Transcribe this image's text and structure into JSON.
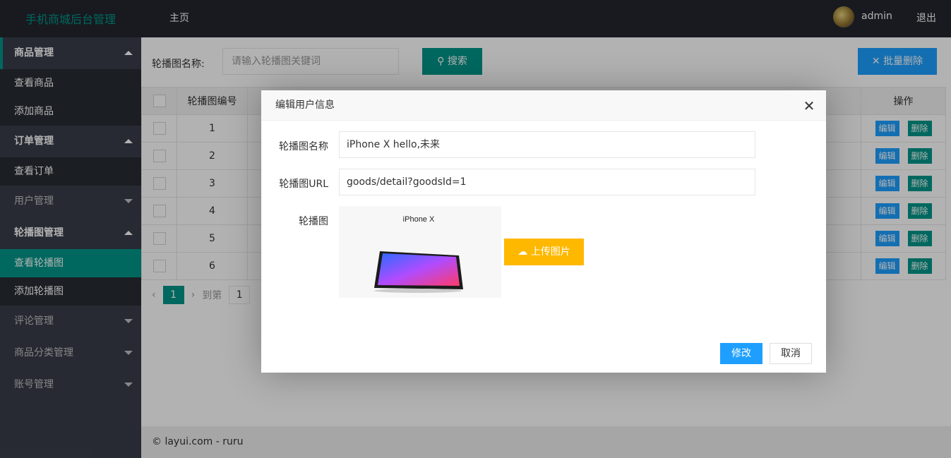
{
  "header": {
    "app_title": "手机商城后台管理",
    "nav_home": "主页",
    "username": "admin",
    "logout": "退出"
  },
  "sidebar": {
    "groups": [
      {
        "label": "商品管理",
        "items": [
          "查看商品",
          "添加商品"
        ]
      },
      {
        "label": "订单管理",
        "items": [
          "查看订单"
        ]
      },
      {
        "label": "用户管理"
      },
      {
        "label": "轮播图管理",
        "items": [
          "查看轮播图",
          "添加轮播图"
        ]
      },
      {
        "label": "评论管理"
      },
      {
        "label": "商品分类管理"
      },
      {
        "label": "账号管理"
      }
    ]
  },
  "toolbar": {
    "search_label": "轮播图名称:",
    "search_placeholder": "请输入轮播图关键词",
    "search_button": "搜索",
    "batch_delete": "批量删除"
  },
  "table": {
    "headers": [
      "轮播图编号",
      "操作"
    ],
    "rows": [
      "1",
      "2",
      "3",
      "4",
      "5",
      "6"
    ],
    "edit_label": "编辑",
    "delete_label": "删除"
  },
  "pager": {
    "current": "1",
    "goto_label": "到第",
    "goto_value": "1"
  },
  "footer": {
    "text": "© layui.com - ruru"
  },
  "dialog": {
    "title": "编辑用户信息",
    "name_label": "轮播图名称",
    "name_value": "iPhone X hello,未来",
    "url_label": "轮播图URL",
    "url_value": "goods/detail?goodsId=1",
    "image_label": "轮播图",
    "image_caption": "iPhone X",
    "upload_button": "上传图片",
    "ok_button": "修改",
    "cancel_button": "取消"
  },
  "colors": {
    "primary": "#009688",
    "blue": "#1e9fff",
    "warm": "#ffb800",
    "dark": "#23262e",
    "side": "#393d49"
  }
}
